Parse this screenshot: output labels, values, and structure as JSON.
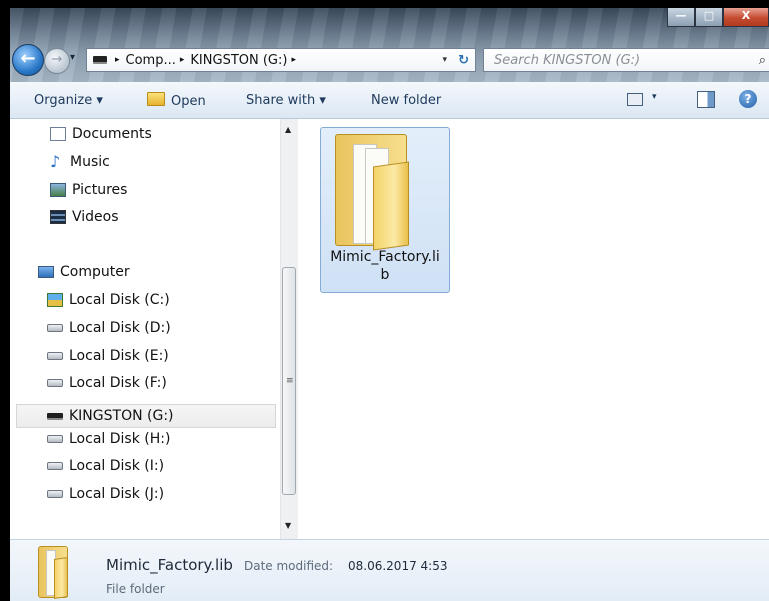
{
  "window": {
    "caption_buttons": {
      "minimize": "—",
      "maximize": "□",
      "close": "X"
    }
  },
  "address_bar": {
    "segments": [
      "Comp...",
      "KINGSTON (G:)"
    ],
    "separator": "▸",
    "dropdown_glyph": "▾",
    "refresh_glyph": "↻"
  },
  "search": {
    "placeholder": "Search KINGSTON (G:)",
    "icon": "magnifier-icon"
  },
  "toolbar": {
    "organize": "Organize ▾",
    "open": "Open",
    "share_with": "Share with ▾",
    "new_folder": "New folder",
    "view_dropdown": "▾",
    "help": "?"
  },
  "nav": {
    "items": [
      {
        "label": "Documents",
        "icon": "documents-icon"
      },
      {
        "label": "Music",
        "icon": "music-icon"
      },
      {
        "label": "Pictures",
        "icon": "pictures-icon"
      },
      {
        "label": "Videos",
        "icon": "videos-icon"
      },
      {
        "label": "Computer",
        "icon": "computer-icon"
      },
      {
        "label": "Local Disk (C:)",
        "icon": "system-drive-icon"
      },
      {
        "label": "Local Disk (D:)",
        "icon": "hard-drive-icon"
      },
      {
        "label": "Local Disk (E:)",
        "icon": "hard-drive-icon"
      },
      {
        "label": "Local Disk (F:)",
        "icon": "hard-drive-icon"
      },
      {
        "label": "KINGSTON (G:)",
        "icon": "usb-drive-icon",
        "selected": true
      },
      {
        "label": "Local Disk (H:)",
        "icon": "hard-drive-icon"
      },
      {
        "label": "Local Disk (I:)",
        "icon": "hard-drive-icon"
      },
      {
        "label": "Local Disk (J:)",
        "icon": "hard-drive-icon"
      }
    ],
    "scroll_up": "▲",
    "scroll_down": "▼",
    "scroll_grip": "≡"
  },
  "content": {
    "items": [
      {
        "name": "Mimic_Factory.lib",
        "type": "folder",
        "selected": true
      }
    ]
  },
  "details": {
    "name": "Mimic_Factory.lib",
    "date_modified_label": "Date modified:",
    "date_modified_value": "08.06.2017 4:53",
    "type": "File folder"
  },
  "colors": {
    "selection_fill": "#cfe1f5",
    "selection_border": "#84acd6",
    "toolbar_text": "#1e395b",
    "folder_yellow": "#f4d468"
  }
}
